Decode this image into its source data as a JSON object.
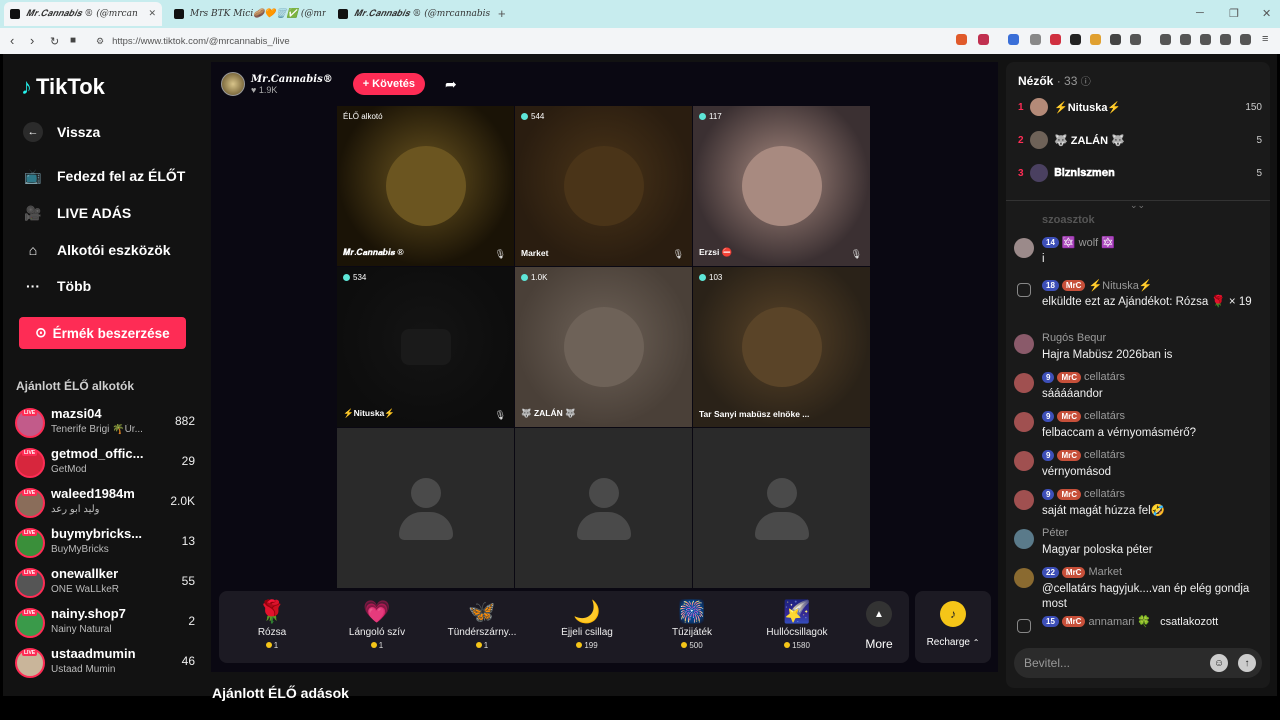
{
  "browser": {
    "tabs": [
      {
        "title": "𝑴𝒓.𝑪𝒂𝒏𝒏𝒂𝒃𝒊𝒔 ® (@mrcan"
      },
      {
        "title": "Mrs BTK Mici🥔🧡🗑️✅ (@mrsbtk) £"
      },
      {
        "title": "𝑴𝒓.𝑪𝒂𝒏𝒏𝒂𝒃𝒊𝒔 ® (@mrcannabis_)"
      }
    ],
    "url": "https://www.tiktok.com/@mrcannabis_/live"
  },
  "sidebar": {
    "logo": "TikTok",
    "back": "Vissza",
    "nav": [
      {
        "label": "Fedezd fel az ÉLŐT",
        "icon": "tv-icon"
      },
      {
        "label": "LIVE ADÁS",
        "icon": "camera-icon"
      },
      {
        "label": "Alkotói eszközök",
        "icon": "creator-tools-icon"
      },
      {
        "label": "Több",
        "icon": "more-icon"
      }
    ],
    "coin_button": "Érmék beszerzése",
    "section_title": "Ajánlott ÉLŐ alkotók",
    "creators": [
      {
        "name": "mazsi04",
        "sub": "Tenerife Brigi 🌴Úr...",
        "count": "882",
        "color": "#c25b8a"
      },
      {
        "name": "getmod_offic...",
        "sub": "GetMod",
        "count": "29",
        "color": "#d7263d"
      },
      {
        "name": "waleed1984m",
        "sub": "وليد ابو رعد",
        "count": "2.0K",
        "color": "#8a6d5a"
      },
      {
        "name": "buymybricks...",
        "sub": "BuyMyBricks",
        "count": "13",
        "color": "#3a8f3a"
      },
      {
        "name": "onewallker",
        "sub": "ONE WaLLkeR",
        "count": "55",
        "color": "#555"
      },
      {
        "name": "nainy.shop7",
        "sub": "Nainy Natural",
        "count": "2",
        "color": "#3a9a4a"
      },
      {
        "name": "ustaadmumin",
        "sub": "Ustaad Mumin",
        "count": "46",
        "color": "#c9b59a"
      }
    ]
  },
  "host": {
    "name": "𝑴𝒓.𝑪𝒂𝒏𝒏𝒂𝒃𝒊𝒔®",
    "likes": "1.9K",
    "follow": "+ Követés"
  },
  "grid": [
    {
      "badge": "ÉLŐ alkotó",
      "count": "",
      "label": "𝑴𝒓.𝑪𝒂𝒏𝒏𝒂𝒃𝒊𝒔 ®",
      "bg": "#1a1306",
      "circle": "#6b5520"
    },
    {
      "badge": "",
      "count": "544",
      "label": "Market",
      "bg": "#2a1d10",
      "circle": "#4a3418"
    },
    {
      "badge": "",
      "count": "117",
      "label": "Erzsi ⛔",
      "bg": "#3b3032",
      "circle": "#a88a80"
    },
    {
      "badge": "",
      "count": "534",
      "label": "⚡Nituska⚡",
      "bg": "#0d0d0d",
      "circle": "#141414"
    },
    {
      "badge": "",
      "count": "1.0K",
      "label": "🐺 ZALÁN 🐺",
      "bg": "#4a4038",
      "circle": "#6e6258"
    },
    {
      "badge": "",
      "count": "103",
      "label": "Tar Sanyi mabüsz elnöke ...",
      "bg": "#2a2218",
      "circle": "#5a4428"
    }
  ],
  "gifts": [
    {
      "name": "Rózsa",
      "price": "1",
      "icon": "🌹"
    },
    {
      "name": "Lángoló szív",
      "price": "1",
      "icon": "💗"
    },
    {
      "name": "Tündérszárny...",
      "price": "1",
      "icon": "🦋"
    },
    {
      "name": "Éjjeli csillag",
      "price": "199",
      "icon": "🌙"
    },
    {
      "name": "Tűzijáték",
      "price": "500",
      "icon": "🎆"
    },
    {
      "name": "Hullócsillagok",
      "price": "1580",
      "icon": "🌠"
    }
  ],
  "more_label": "More",
  "recharge_label": "Recharge",
  "bottom_heading": "Ajánlott ÉLŐ adások",
  "viewers": {
    "title": "Nézők",
    "count": "33",
    "ranks": [
      {
        "rank": "1",
        "name": "⚡Nituska⚡",
        "value": "150",
        "color": "#b48a78"
      },
      {
        "rank": "2",
        "name": "🐺 ZALÁN 🐺",
        "value": "5",
        "color": "#6e6258"
      },
      {
        "rank": "3",
        "name": "𝐁𝐢𝐳𝐧𝐢𝐬𝐳𝐦𝐞𝐧",
        "value": "5",
        "color": "#4a4060"
      }
    ],
    "faded": "szoasztok"
  },
  "chat": [
    {
      "lvl": "14",
      "fan": "",
      "user": "🔯 wolf 🔯",
      "text": "i",
      "color": "#9b8a8a"
    },
    {
      "lvl": "18",
      "fan": "MrC",
      "user": "⚡Nituska⚡",
      "text": "elküldte ezt az Ajándékot: Rózsa 🌹 × 19",
      "color": "#444",
      "gift": true
    },
    {
      "lvl": "",
      "fan": "",
      "user": "Rugós Bequr",
      "text": "Hajra Mabüsz 2026ban is",
      "color": "#8a5a6a"
    },
    {
      "lvl": "9",
      "fan": "MrC",
      "user": "cellatárs",
      "text": "sááááandor",
      "color": "#a05050"
    },
    {
      "lvl": "9",
      "fan": "MrC",
      "user": "cellatárs",
      "text": "felbaccam a vérnyomásmérő?",
      "color": "#a05050"
    },
    {
      "lvl": "9",
      "fan": "MrC",
      "user": "cellatárs",
      "text": "vérnyomásod",
      "color": "#a05050"
    },
    {
      "lvl": "9",
      "fan": "MrC",
      "user": "cellatárs",
      "text": "saját magát húzza fel🤣",
      "color": "#a05050"
    },
    {
      "lvl": "",
      "fan": "",
      "user": "Péter",
      "text": "Magyar poloska péter",
      "color": "#5a7a8a"
    },
    {
      "lvl": "22",
      "fan": "MrC",
      "user": "Market",
      "text": "@cellatárs hagyjuk....van ép elég gondja most",
      "color": "#8a6a30"
    },
    {
      "lvl": "15",
      "fan": "MrC",
      "user": "annamari 🍀",
      "text": "csatlakozott",
      "color": "#333",
      "join": true
    }
  ],
  "input_placeholder": "Bevitel..."
}
